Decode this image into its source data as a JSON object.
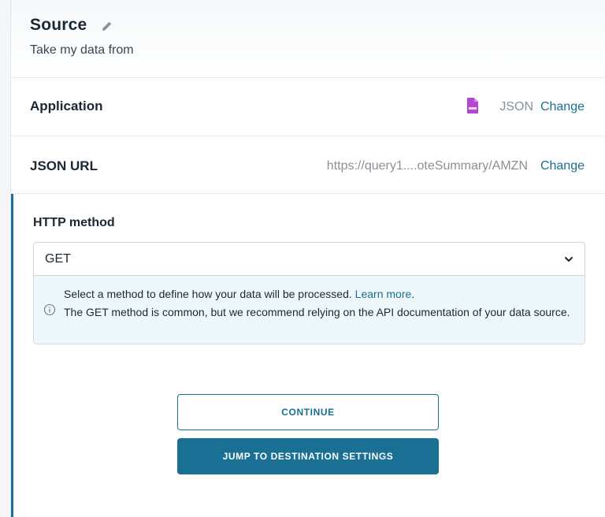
{
  "header": {
    "title": "Source",
    "subtitle": "Take my data from",
    "edit_icon": "pencil-icon"
  },
  "application_row": {
    "label": "Application",
    "value": "JSON",
    "icon": "json-file-icon",
    "icon_color": "#b545d4",
    "change_label": "Change"
  },
  "url_row": {
    "label": "JSON URL",
    "value": "https://query1....oteSummary/AMZN",
    "change_label": "Change"
  },
  "http_method": {
    "label": "HTTP method",
    "selected": "GET",
    "info_line1": "Select a method to define how your data will be processed.",
    "learn_more": "Learn more",
    "info_line1_end": ".",
    "info_line2": "The GET method is common, but we recommend relying on the API documentation of your data source."
  },
  "actions": {
    "continue_label": "CONTINUE",
    "jump_label": "JUMP TO DESTINATION SETTINGS"
  },
  "colors": {
    "accent": "#1a6f94",
    "info_bg": "#eef8fb"
  }
}
